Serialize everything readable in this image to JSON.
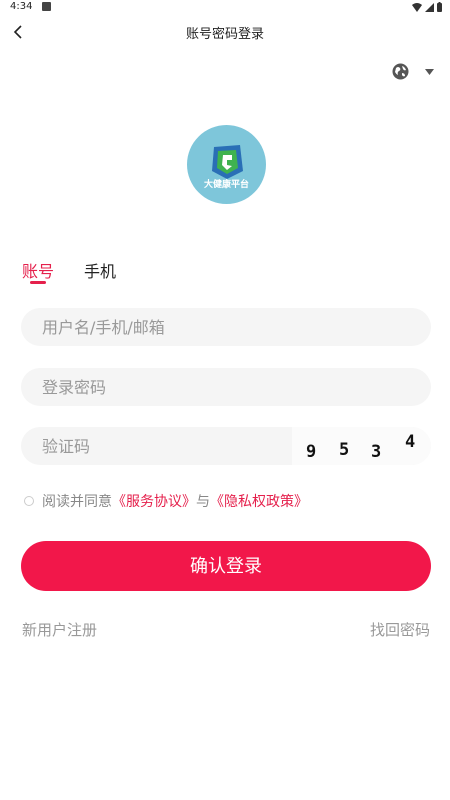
{
  "status_bar": {
    "time": "4:34"
  },
  "nav": {
    "title": "账号密码登录"
  },
  "tabs": [
    {
      "label": "账号"
    },
    {
      "label": "手机"
    }
  ],
  "logo": {
    "text": "大健康平台"
  },
  "form": {
    "username_placeholder": "用户名/手机/邮箱",
    "password_placeholder": "登录密码",
    "code_placeholder": "验证码",
    "captcha_digits": [
      "9",
      "5",
      "3",
      "4"
    ]
  },
  "agreement": {
    "prefix": "阅读并同意",
    "service_link": "《服务协议》",
    "joiner": "与",
    "privacy_link": "《隐私权政策》"
  },
  "submit_label": "确认登录",
  "links": {
    "register": "新用户注册",
    "forgot": "找回密码"
  },
  "colors": {
    "accent": "#f2174a",
    "field_bg": "#f5f5f5"
  },
  "icons": {
    "back": "chevron-left-icon",
    "language": "globe-icon",
    "dropdown": "caret-down-icon"
  }
}
